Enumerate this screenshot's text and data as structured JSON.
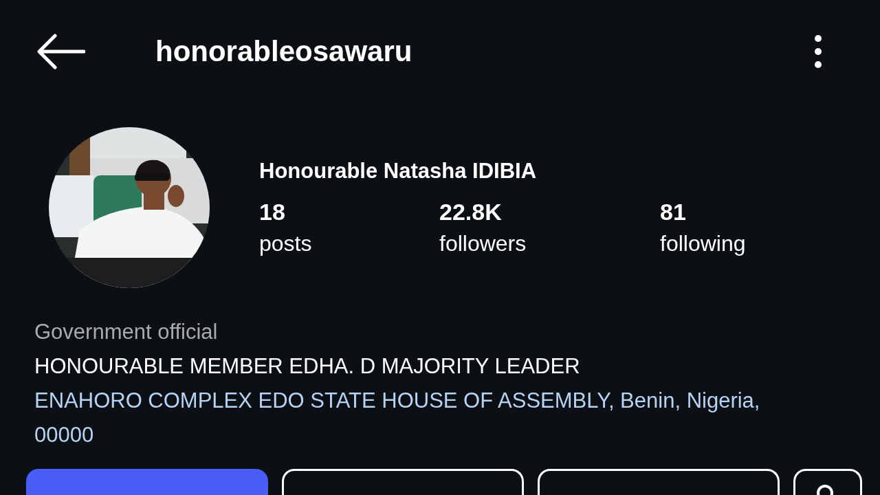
{
  "header": {
    "username": "honorableosawaru"
  },
  "profile": {
    "kind": "picture",
    "display_name": "Honourable Natasha IDIBIA",
    "stats": [
      {
        "value": "18",
        "label": "posts"
      },
      {
        "value": "22.8K",
        "label": "followers"
      },
      {
        "value": "81",
        "label": "following"
      }
    ]
  },
  "bio": {
    "category": "Government official",
    "text": "HONOURABLE MEMBER EDHA. D MAJORITY LEADER",
    "address": "ENAHORO COMPLEX EDO STATE HOUSE OF ASSEMBLY, Benin, Nigeria, 00000"
  },
  "buttons": [
    {
      "kind": "primary"
    },
    {
      "kind": "outline"
    },
    {
      "kind": "outline"
    },
    {
      "kind": "icon"
    }
  ]
}
